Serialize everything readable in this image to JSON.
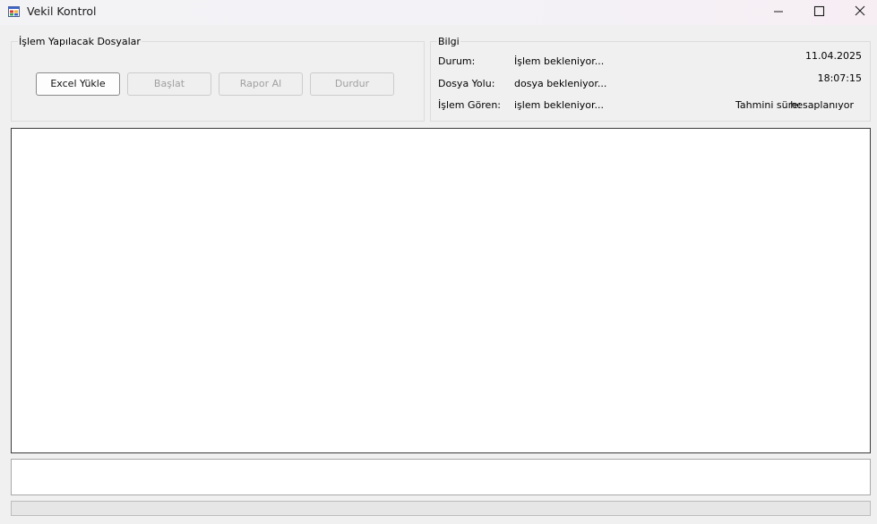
{
  "window": {
    "title": "Vekil Kontrol"
  },
  "files_group": {
    "title": "İşlem Yapılacak Dosyalar",
    "buttons": {
      "excel_upload": "Excel Yükle",
      "start": "Başlat",
      "report": "Rapor Al",
      "stop": "Durdur"
    }
  },
  "info_group": {
    "title": "Bilgi",
    "status_label": "Durum:",
    "status_value": "İşlem bekleniyor...",
    "file_path_label": "Dosya Yolu:",
    "file_path_value": "dosya bekleniyor...",
    "processed_label": "İşlem Gören:",
    "processed_value": "işlem bekleniyor...",
    "date": "11.04.2025",
    "time": "18:07:15",
    "estimate_label": "Tahmini süre:",
    "estimate_value": "hesaplanıyor"
  },
  "progress": {
    "value": 0
  },
  "colors": {
    "accent": "#06b025",
    "window_bg": "#f0f0f0",
    "disabled_text": "#a0a0a0"
  },
  "icons": {
    "app": "app-window-icon",
    "minimize": "minimize-icon",
    "maximize": "maximize-icon",
    "close": "close-icon"
  }
}
